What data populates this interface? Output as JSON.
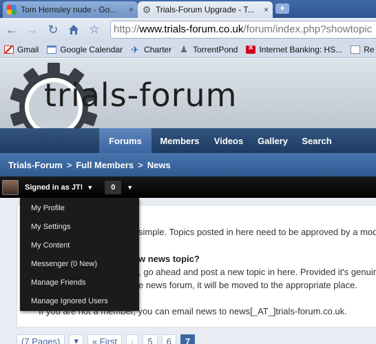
{
  "browser": {
    "tabs": [
      {
        "title": "Tom Hemsley nude - Go...",
        "favicon": "google-icon",
        "active": false
      },
      {
        "title": "Trials-Forum Upgrade - T...",
        "favicon": "gear-icon",
        "active": true
      }
    ],
    "tab_close": "×",
    "new_tab": "+",
    "url_prefix": "http://",
    "url_host": "www.trials-forum.co.uk",
    "url_path": "/forum/index.php?showtopic",
    "bookmarks": [
      {
        "label": "Gmail",
        "icon": "gmail-icon"
      },
      {
        "label": "Google Calendar",
        "icon": "calendar-icon"
      },
      {
        "label": "Charter",
        "icon": "charter-icon"
      },
      {
        "label": "TorrentPond",
        "icon": "torrent-icon"
      },
      {
        "label": "Internet Banking: HS...",
        "icon": "bank-icon"
      },
      {
        "label": "Re",
        "icon": "page-icon"
      }
    ]
  },
  "site": {
    "logo_text": "trials-forum",
    "nav": [
      "Forums",
      "Members",
      "Videos",
      "Gallery",
      "Search"
    ],
    "active_nav": "Forums",
    "breadcrumb": [
      "Trials-Forum",
      "Full Members",
      "News"
    ],
    "breadcrumb_sep": ">"
  },
  "userbar": {
    "signed_in": "Signed in as JT!",
    "notifications": "0"
  },
  "menu": {
    "items": [
      "My Profile",
      "My Settings",
      "My Content",
      "Messenger (0 New)",
      "Manage Friends",
      "Manage Ignored Users"
    ]
  },
  "content": {
    "line1": "simple. Topics posted in here need to be approved by a mod",
    "heading": "w news topic?",
    "line2": ", go ahead and post a new topic in here. Provided it's genuin",
    "line3": "e news forum, it will be moved to the appropriate place.",
    "line4": "If you are not a member, you can email news to news[_AT_]trials-forum.co.uk."
  },
  "pagination": {
    "pages_label": "(7 Pages)",
    "dropdown": "▾",
    "first": "« First",
    "prev": "‹",
    "pages": [
      "5",
      "6",
      "7"
    ],
    "current": "7"
  }
}
